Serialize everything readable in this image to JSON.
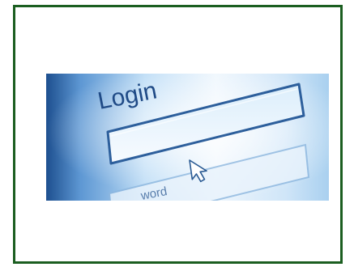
{
  "frame": {
    "border_color": "#1b5e20"
  },
  "photo": {
    "label_text": "Login",
    "partial_label_text": "word",
    "colors": {
      "background_light": "#eef6fd",
      "background_mid": "#a9d0ef",
      "background_dark": "#1d4f8f",
      "label": "#1f4a86",
      "field_border": "#2d5f9c"
    },
    "icons": [
      "mouse-pointer-icon"
    ]
  }
}
